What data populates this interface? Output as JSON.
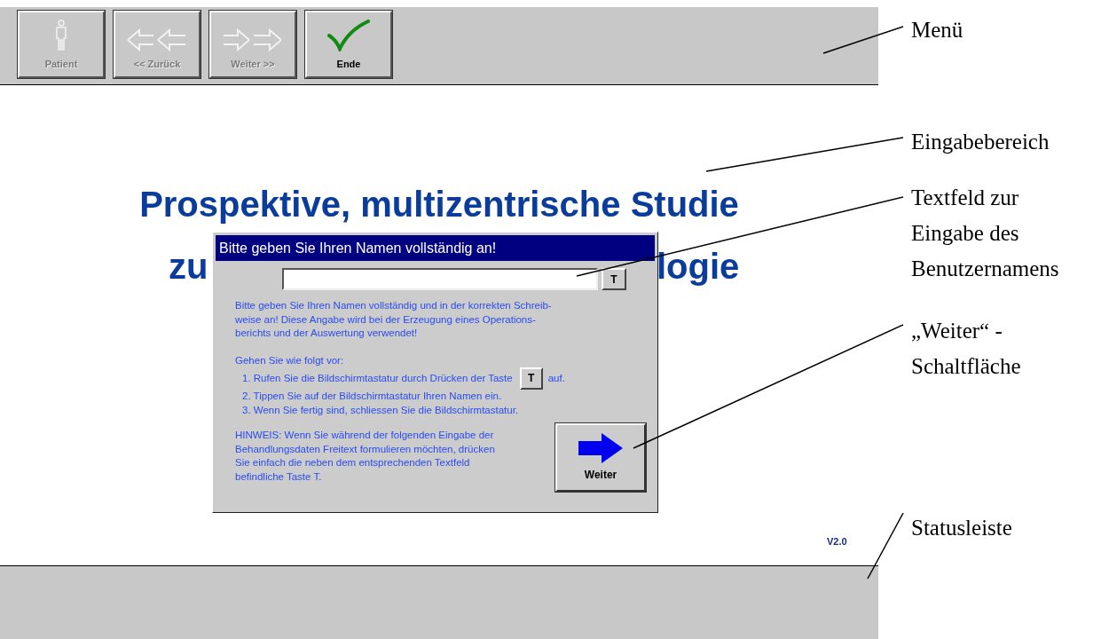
{
  "menu_bar": {
    "buttons": [
      {
        "kind": "patient",
        "label": "Patient",
        "disabled": true
      },
      {
        "kind": "back",
        "label": "<< Zurück",
        "disabled": true
      },
      {
        "kind": "forward",
        "label": "Weiter >>",
        "disabled": true
      },
      {
        "kind": "finish",
        "label": "Ende",
        "disabled": false
      }
    ]
  },
  "input_area": {
    "title_line_1": "Prospektive, multizentrische Studie",
    "title_line_2_left": "zu",
    "title_line_2_right": "logie",
    "version": "V2.0"
  },
  "dialog": {
    "title": "Bitte geben Sie Ihren Namen vollständig an!",
    "keyboard_button": "T",
    "intro": "Bitte geben Sie Ihren Namen vollständig und in der korrekten Schreib-\nweise an! Diese Angabe wird bei der Erzeugung eines Operations-\nberichts und der Auswertung verwendet!",
    "steps_heading": "Gehen Sie wie folgt vor:",
    "steps": [
      {
        "text": "1.  Rufen Sie die Bildschirmtastatur durch Drücken der Taste",
        "key": "T",
        "after": "auf."
      },
      {
        "text": "2. Tippen Sie auf der Bildschirmtastatur Ihren Namen ein."
      },
      {
        "text": "3. Wenn Sie fertig sind, schliessen Sie die Bildschirmtastatur."
      }
    ],
    "note": "HINWEIS: Wenn Sie während der folgenden Eingabe der\nBehandlungsdaten Freitext formulieren möchten, drücken\nSie einfach die neben dem entsprechenden Textfeld\nbefindliche Taste T.",
    "next_button": "Weiter"
  },
  "annotations": [
    {
      "text": "Menü"
    },
    {
      "text": "Eingabebereich"
    },
    {
      "text": "Textfeld zur\nEingabe des\nBenutzernamens"
    },
    {
      "text": "„Weiter“ -\nSchaltfläche"
    },
    {
      "text": "Statusleiste"
    }
  ]
}
